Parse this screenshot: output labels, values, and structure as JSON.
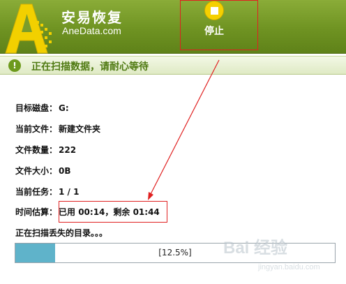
{
  "header": {
    "app_name": "安易恢复",
    "app_domain": "AneData.com",
    "stop_label": "停止"
  },
  "status": {
    "icon_glyph": "!",
    "text": "正在扫描数据，请耐心等待"
  },
  "info": {
    "target_disk_label": "目标磁盘：",
    "target_disk_value": "G:",
    "current_file_label": "当前文件：",
    "current_file_value": "新建文件夹",
    "file_count_label": "文件数量：",
    "file_count_value": "222",
    "file_size_label": "文件大小：",
    "file_size_value": "0B",
    "current_task_label": "当前任务：",
    "current_task_value": "1 / 1",
    "time_estimate_label": "时间估算：",
    "time_estimate_value": "已用 00:14，剩余 01:44",
    "scan_message": "正在扫描丢失的目录。。。"
  },
  "progress": {
    "percent": 12.5,
    "text": "[12.5%]"
  },
  "watermark": {
    "main": "Bai 经验",
    "sub": "jingyan.baidu.com"
  },
  "colors": {
    "header_green": "#6f9322",
    "status_text": "#4f7a12",
    "progress_fill": "#5fb3ca",
    "annotation_red": "#e02020"
  }
}
